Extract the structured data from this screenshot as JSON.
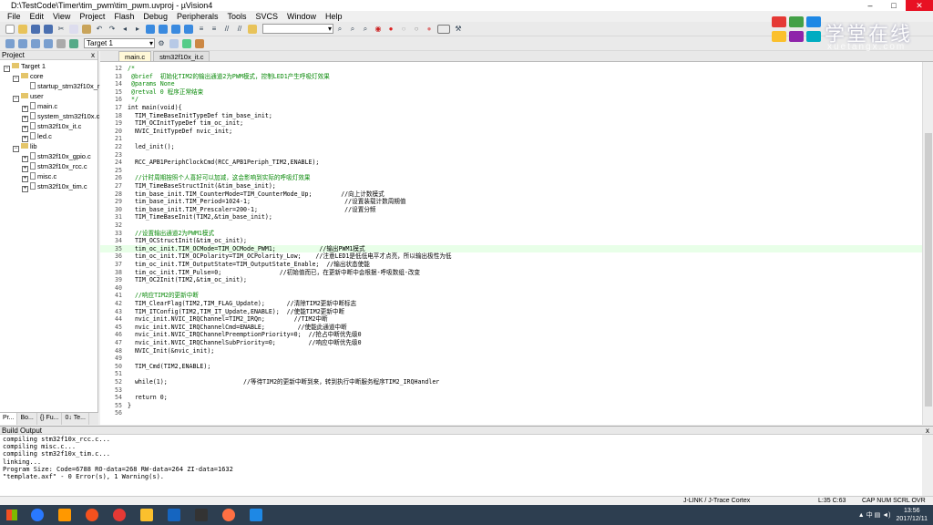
{
  "window": {
    "title": "D:\\TestCode\\Timer\\tim_pwm\\tim_pwm.uvproj - µVision4",
    "controls": [
      "–",
      "□",
      "✕"
    ]
  },
  "menu": [
    "File",
    "Edit",
    "View",
    "Project",
    "Flash",
    "Debug",
    "Peripherals",
    "Tools",
    "SVCS",
    "Window",
    "Help"
  ],
  "toolbar": {
    "target_select": "Target 1",
    "find_combo": ""
  },
  "brand": {
    "name": "学堂在线",
    "sub": "xuetangx.com",
    "colors": [
      "#e53935",
      "#43a047",
      "#1e88e5",
      "#fbc02d",
      "#8e24aa",
      "#00acc1"
    ]
  },
  "project": {
    "header": "Project",
    "close": "x",
    "tree": [
      {
        "label": "Target 1",
        "level": 0,
        "type": "root",
        "toggle": "−"
      },
      {
        "label": "core",
        "level": 1,
        "type": "folder",
        "toggle": "−"
      },
      {
        "label": "startup_stm32f10x_r",
        "level": 2,
        "type": "file",
        "toggle": ""
      },
      {
        "label": "user",
        "level": 1,
        "type": "folder",
        "toggle": "−"
      },
      {
        "label": "main.c",
        "level": 2,
        "type": "file",
        "toggle": "+"
      },
      {
        "label": "system_stm32f10x.c",
        "level": 2,
        "type": "file",
        "toggle": "+"
      },
      {
        "label": "stm32f10x_it.c",
        "level": 2,
        "type": "file",
        "toggle": "+"
      },
      {
        "label": "led.c",
        "level": 2,
        "type": "file",
        "toggle": "+"
      },
      {
        "label": "lib",
        "level": 1,
        "type": "folder",
        "toggle": "−"
      },
      {
        "label": "stm32f10x_gpio.c",
        "level": 2,
        "type": "file",
        "toggle": "+"
      },
      {
        "label": "stm32f10x_rcc.c",
        "level": 2,
        "type": "file",
        "toggle": "+"
      },
      {
        "label": "misc.c",
        "level": 2,
        "type": "file",
        "toggle": "+"
      },
      {
        "label": "stm32f10x_tim.c",
        "level": 2,
        "type": "file",
        "toggle": "+"
      }
    ],
    "tabs": [
      "Pr...",
      "Bo...",
      "{} Fu...",
      "0↓ Te..."
    ]
  },
  "editor": {
    "tabs": [
      {
        "label": "main.c",
        "active": true
      },
      {
        "label": "stm32f10x_it.c",
        "active": false
      }
    ],
    "highlight_line": 35,
    "lines": [
      {
        "n": "12",
        "t": "/*"
      },
      {
        "n": "13",
        "t": " @brief  初始化TIM2的输出通道2为PWM模式，控制LED1产生呼吸灯效果"
      },
      {
        "n": "14",
        "t": " @params None"
      },
      {
        "n": "15",
        "t": " @retval 0 程序正常结束"
      },
      {
        "n": "16",
        "t": " */"
      },
      {
        "n": "17",
        "t": "int main(void){"
      },
      {
        "n": "18",
        "t": "  TIM_TimeBaseInitTypeDef tim_base_init;"
      },
      {
        "n": "19",
        "t": "  TIM_OCInitTypeDef tim_oc_init;"
      },
      {
        "n": "20",
        "t": "  NVIC_InitTypeDef nvic_init;"
      },
      {
        "n": "21",
        "t": ""
      },
      {
        "n": "22",
        "t": "  led_init();"
      },
      {
        "n": "23",
        "t": ""
      },
      {
        "n": "24",
        "t": "  RCC_APB1PeriphClockCmd(RCC_APB1Periph_TIM2,ENABLE);"
      },
      {
        "n": "25",
        "t": ""
      },
      {
        "n": "26",
        "t": "  //计时周期按照个人喜好可以加减，这会影响到实际的呼吸灯效果"
      },
      {
        "n": "27",
        "t": "  TIM_TimeBaseStructInit(&tim_base_init);"
      },
      {
        "n": "28",
        "t": "  tim_base_init.TIM_CounterMode=TIM_CounterMode_Up;        //向上计数模式"
      },
      {
        "n": "29",
        "t": "  tim_base_init.TIM_Period=1024-1;                          //设置装载计数周期值"
      },
      {
        "n": "30",
        "t": "  tim_base_init.TIM_Prescaler=200-1;                        //设置分频"
      },
      {
        "n": "31",
        "t": "  TIM_TimeBaseInit(TIM2,&tim_base_init);"
      },
      {
        "n": "32",
        "t": ""
      },
      {
        "n": "33",
        "t": "  //设置输出通道2为PWM1模式"
      },
      {
        "n": "34",
        "t": "  TIM_OCStructInit(&tim_oc_init);"
      },
      {
        "n": "35",
        "t": "  tim_oc_init.TIM_OCMode=TIM_OCMode_PWM1;            //输出PWM1模式"
      },
      {
        "n": "36",
        "t": "  tim_oc_init.TIM_OCPolarity=TIM_OCPolarity_Low;    //注意LED1是低低电平才点亮，所以输出极性为低"
      },
      {
        "n": "37",
        "t": "  tim_oc_init.TIM_OutputState=TIM_OutputState_Enable;  //输出状态使能"
      },
      {
        "n": "38",
        "t": "  tim_oc_init.TIM_Pulse=0;                //初始值而已，在更新中断中会根据-呼吸数组-改变"
      },
      {
        "n": "39",
        "t": "  TIM_OC2Init(TIM2,&tim_oc_init);"
      },
      {
        "n": "40",
        "t": ""
      },
      {
        "n": "41",
        "t": "  //响应TIM2的更新中断"
      },
      {
        "n": "42",
        "t": "  TIM_ClearFlag(TIM2,TIM_FLAG_Update);      //清除TIM2更新中断标志"
      },
      {
        "n": "43",
        "t": "  TIM_ITConfig(TIM2,TIM_IT_Update,ENABLE);  //使能TIM2更新中断"
      },
      {
        "n": "44",
        "t": "  nvic_init.NVIC_IRQChannel=TIM2_IRQn;        //TIM2中断"
      },
      {
        "n": "45",
        "t": "  nvic_init.NVIC_IRQChannelCmd=ENABLE;         //使能此通道中断"
      },
      {
        "n": "46",
        "t": "  nvic_init.NVIC_IRQChannelPreemptionPriority=0;  //抢占中断优先级0"
      },
      {
        "n": "47",
        "t": "  nvic_init.NVIC_IRQChannelSubPriority=0;         //响应中断优先级0"
      },
      {
        "n": "48",
        "t": "  NVIC_Init(&nvic_init);"
      },
      {
        "n": "49",
        "t": ""
      },
      {
        "n": "50",
        "t": "  TIM_Cmd(TIM2,ENABLE);"
      },
      {
        "n": "51",
        "t": ""
      },
      {
        "n": "52",
        "t": "  while(1);                     //等待TIM2的更新中断到来，转到执行中断服务程序TIM2_IRQHandler"
      },
      {
        "n": "53",
        "t": ""
      },
      {
        "n": "54",
        "t": "  return 0;"
      },
      {
        "n": "55",
        "t": "}"
      },
      {
        "n": "56",
        "t": ""
      }
    ]
  },
  "build": {
    "header": "Build Output",
    "close": "x",
    "lines": [
      "compiling stm32f10x_rcc.c...",
      "compiling misc.c...",
      "compiling stm32f10x_tim.c...",
      "linking...",
      "Program Size: Code=6788 RO-data=268 RW-data=264 ZI-data=1632",
      "\"template.axf\" - 0 Error(s), 1 Warning(s)."
    ]
  },
  "status": {
    "debugger": "J-LINK / J-Trace Cortex",
    "position": "L:35 C:63",
    "flags": "CAP  NUM  SCRL  OVR  R/W"
  },
  "taskbar": {
    "time": "13:56",
    "date": "2017/12/11",
    "tray_text": "中",
    "app_colors": [
      "#2979ff",
      "#ff9800",
      "#f4511e",
      "#e53935",
      "#fbc02d",
      "#1565c0",
      "#333333",
      "#ff7043",
      "#1e88e5"
    ]
  }
}
